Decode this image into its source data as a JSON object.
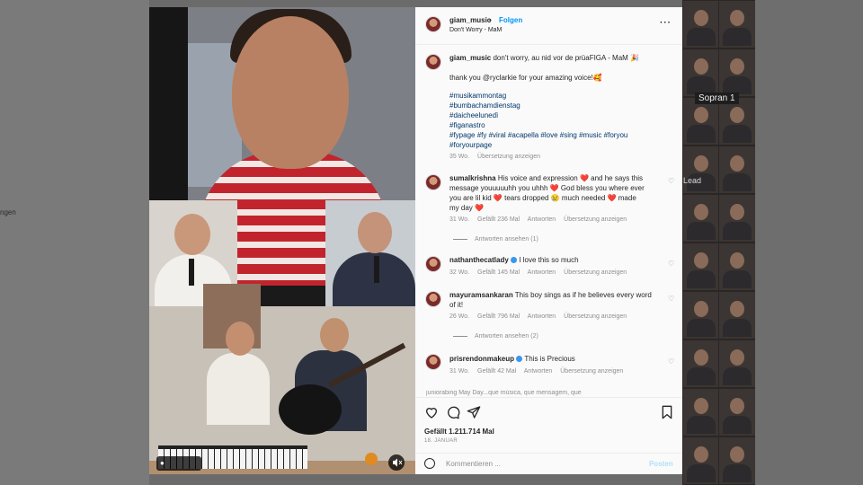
{
  "background": {
    "left_text": "ngen",
    "tile_labels": [
      "Sopran 1",
      "Lead"
    ]
  },
  "video": {
    "user_chip": "",
    "mute_icon": "speaker-off-icon"
  },
  "post": {
    "header": {
      "username": "giam_music",
      "separator": "•",
      "follow_label": "Folgen",
      "audio_label": "Don't Worry - MaM",
      "more_icon": "more-horizontal-icon"
    },
    "caption": {
      "username": "giam_music",
      "text": "don't worry, au nid vor de prüaFIGA - MaM 🎉",
      "thanks": "thank you @ryclarkie for your amazing voice!🥰",
      "hashtags": [
        "#musikammontag",
        "#bumbachamdienstag",
        "#daicheelunedì",
        "#figanastro",
        "#fypage #fy #viral #acapella #love #sing #music #foryou",
        "#foryourpage"
      ],
      "meta_age": "35 Wo.",
      "meta_translate": "Übersetzung anzeigen"
    },
    "comments": [
      {
        "username": "sumalkrishna",
        "lines": [
          "His voice and expression ❤️ and he says this",
          "message youuuuuhh you uhhh ❤️ God bless you where ever",
          "you are lil kid ❤️ tears dropped 😢 much needed ❤️ made",
          "my day ❤️"
        ],
        "age": "31 Wo.",
        "likes": "Gefällt 236 Mal",
        "reply": "Antworten",
        "translate": "Übersetzung anzeigen",
        "view_replies": "Antworten ansehen (1)"
      },
      {
        "username": "nathanthecatlady",
        "lines": [
          "I love this so much"
        ],
        "age": "32 Wo.",
        "likes": "Gefällt 145 Mal",
        "reply": "Antworten",
        "translate": "Übersetzung anzeigen"
      },
      {
        "username": "mayuramsankaran",
        "lines": [
          "This boy sings as if he believes every word",
          "of it!"
        ],
        "age": "26 Wo.",
        "likes": "Gefällt 796 Mal",
        "reply": "Antworten",
        "translate": "Übersetzung anzeigen",
        "view_replies": "Antworten ansehen (2)"
      },
      {
        "username": "prisrendonmakeup",
        "lines": [
          "This is Precious"
        ],
        "age": "31 Wo.",
        "likes": "Gefällt 42 Mal",
        "reply": "Antworten",
        "translate": "Übersetzung anzeigen"
      }
    ],
    "cut_comment": "juniorabing May Day...que música, que mensagem, que",
    "actions": {
      "like_icon": "heart-icon",
      "comment_icon": "comment-icon",
      "share_icon": "send-icon",
      "save_icon": "bookmark-icon",
      "likes_text": "Gefällt 1.211.714 Mal",
      "date": "18. JANUAR"
    },
    "composer": {
      "placeholder": "Kommentieren ...",
      "post_label": "Posten"
    }
  },
  "colors": {
    "link_blue": "#0095f6",
    "muted_text": "#8e8e8e",
    "heart_red": "#ed4956",
    "panel_bg": "#fafafa"
  }
}
